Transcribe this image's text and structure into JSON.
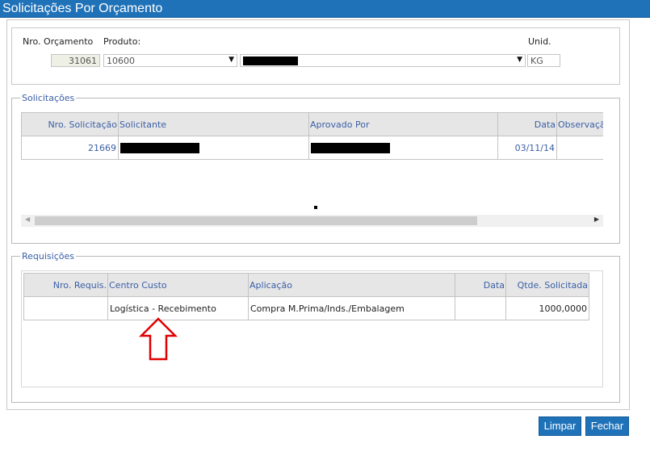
{
  "window": {
    "title": "Solicitações Por Orçamento"
  },
  "header": {
    "nro_orcamento_label": "Nro. Orçamento",
    "nro_orcamento_value": "31061",
    "produto_label": "Produto:",
    "produto_code": "10600",
    "unid_label": "Unid.",
    "unid_value": "KG"
  },
  "solicitacoes": {
    "legend": "Solicitações",
    "columns": [
      "Nro. Solicitação",
      "Solicitante",
      "Aprovado Por",
      "Data",
      "Observaçã"
    ],
    "rows": [
      {
        "nro": "21669",
        "data": "03/11/14"
      }
    ]
  },
  "requisicoes": {
    "legend": "Requisições",
    "columns": [
      "Nro. Requis.",
      "Centro Custo",
      "Aplicação",
      "Data",
      "Qtde. Solicitada"
    ],
    "rows": [
      {
        "nro": "",
        "centro_custo": "Logística - Recebimento",
        "aplicacao": "Compra M.Prima/Inds./Embalagem",
        "data": "",
        "qtde": "1000,0000"
      }
    ]
  },
  "buttons": {
    "limpar": "Limpar",
    "fechar": "Fechar"
  },
  "icons": {
    "select_arrow": "▼",
    "scroll_left": "◀",
    "scroll_right": "▶",
    "annotation": "red-up-arrow"
  },
  "colors": {
    "title_bar": "#1f72b8",
    "link_text": "#3a5fa6",
    "annotation": "#e00000"
  }
}
